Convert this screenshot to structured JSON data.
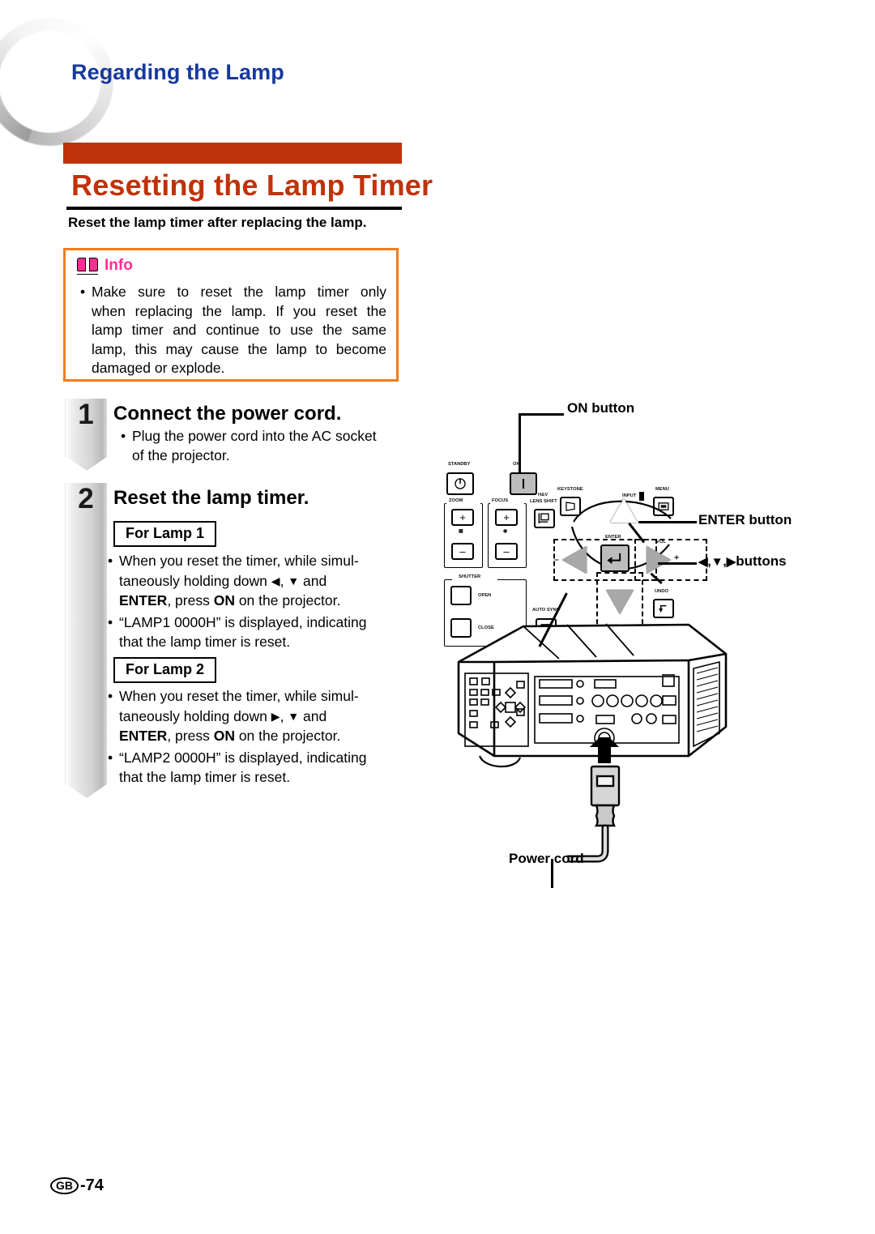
{
  "header": {
    "title": "Regarding the Lamp"
  },
  "section": {
    "title": "Resetting the Lamp Timer",
    "subtitle": "Reset the lamp timer after replacing the lamp."
  },
  "info": {
    "label": "Info",
    "icon": "open-book-icon",
    "bullet": "•",
    "lines": [
      "Make sure to reset the lamp timer only",
      "when replacing the lamp. If you reset the",
      "lamp timer and continue to use the same",
      "lamp, this may cause the lamp to become",
      "damaged or explode."
    ]
  },
  "steps": [
    {
      "number": "1",
      "title": "Connect the power cord.",
      "bullet": "•",
      "lines": [
        "Plug the power cord into the AC socket",
        "of the projector."
      ]
    },
    {
      "number": "2",
      "title": "Reset the lamp timer."
    }
  ],
  "lamp1": {
    "tag": "For Lamp 1",
    "bullet": "•",
    "item1": {
      "l1": "When you reset the timer, while simul-",
      "l2_a": "taneously  holding  down ",
      "l2_arrow1": "◀",
      "l2_b": ",  ",
      "l2_arrow2": "▼",
      "l2_c": "  and",
      "l3_enter": "ENTER",
      "l3_mid": ", press ",
      "l3_on": "ON",
      "l3_end": " on the projector."
    },
    "item2": {
      "l1": "“LAMP1 0000H” is displayed, indicating",
      "l2": "that the lamp timer is reset."
    }
  },
  "lamp2": {
    "tag": "For Lamp 2",
    "bullet": "•",
    "item1": {
      "l1": "When you reset the timer, while simul-",
      "l2_a": "taneously  holding  down  ",
      "l2_arrow1": "▶",
      "l2_b": ",  ",
      "l2_arrow2": "▼",
      "l2_c": "  and",
      "l3_enter": "ENTER",
      "l3_mid": ",  press ",
      "l3_on": "ON",
      "l3_end": " on the projector."
    },
    "item2": {
      "l1": "“LAMP2 0000H” is displayed, indicating",
      "l2": "that the lamp timer is reset."
    }
  },
  "diagram": {
    "callouts": {
      "on_button": "ON button",
      "enter_button": "ENTER button",
      "arrow_buttons_glyphs": "◀,▼,▶",
      "arrow_buttons_text": " buttons",
      "power_cord": "Power cord"
    },
    "panel_labels": {
      "standby": "STANDBY",
      "on": "ON",
      "zoom": "ZOOM",
      "focus": "FOCUS",
      "lens_shift_1": "H&V",
      "lens_shift_2": "LENS SHIFT",
      "shutter": "SHUTTER",
      "open": "OPEN",
      "close": "CLOSE",
      "auto_sync": "AUTO SYNC",
      "keystone": "KEYSTONE",
      "menu": "MENU",
      "input": "INPUT",
      "enter": "ENTER",
      "vol": "VOL",
      "undo": "UNDO",
      "plus": "+",
      "minus": "–"
    }
  },
  "footer": {
    "region": "GB",
    "page": "-74"
  },
  "colors": {
    "header_blue": "#17399c",
    "accent_orange_red": "#c0320a",
    "info_border_orange": "#f07d20",
    "info_pink": "#ff2e92"
  }
}
